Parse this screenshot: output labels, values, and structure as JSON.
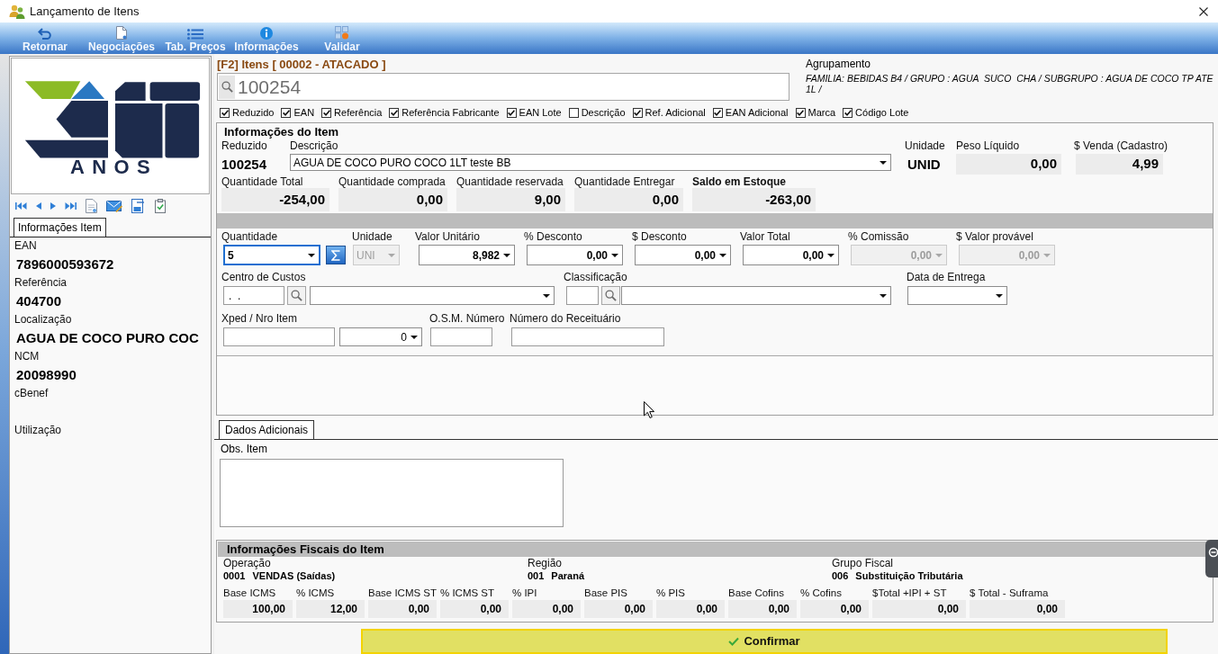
{
  "window": {
    "title": "Lançamento de Itens"
  },
  "toolbar": [
    {
      "label": "Retornar",
      "kind": "return"
    },
    {
      "label": "Negociações",
      "kind": "document"
    },
    {
      "label": "Tab. Preços",
      "kind": "list"
    },
    {
      "label": "Informações",
      "kind": "info"
    },
    {
      "label": "Validar",
      "kind": "validate"
    }
  ],
  "sidebar": {
    "logo_caption": "ANOS",
    "tabs": [
      {
        "label": "Informações Item",
        "selected": true
      }
    ],
    "fields": [
      {
        "label": "EAN",
        "value": "7896000593672"
      },
      {
        "label": "Referência",
        "value": "404700"
      },
      {
        "label": "Localização",
        "value": "AGUA DE COCO PURO COC"
      },
      {
        "label": "NCM",
        "value": "20098990"
      },
      {
        "label": "cBenef"
      },
      {
        "label": "Utilização"
      }
    ]
  },
  "item_search": {
    "title": "[F2] Itens [ 00002 - ATACADO ]",
    "value": "100254"
  },
  "grouping": {
    "label": "Agrupamento",
    "text": "FAMILIA: BEBIDAS B4 / GRUPO : AGUA  SUCO  CHA / SUBGRUPO : AGUA DE COCO TP ATE 1L /"
  },
  "search_filters": [
    {
      "label": "Reduzido",
      "checked": true
    },
    {
      "label": "EAN",
      "checked": true
    },
    {
      "label": "Referência",
      "checked": true
    },
    {
      "label": "Referência Fabricante",
      "checked": true
    },
    {
      "label": "EAN Lote",
      "checked": true
    },
    {
      "label": "Descrição",
      "checked": false
    },
    {
      "label": "Ref. Adicional",
      "checked": true
    },
    {
      "label": "EAN Adicional",
      "checked": true
    },
    {
      "label": "Marca",
      "checked": true
    },
    {
      "label": "Código Lote",
      "checked": true
    }
  ],
  "item_info": {
    "title": "Informações do Item",
    "code": {
      "label": "Reduzido",
      "value": "100254"
    },
    "description": {
      "label": "Descrição",
      "value": "AGUA DE COCO PURO COCO 1LT teste BB"
    },
    "unit": {
      "label": "Unidade",
      "value": "UNID"
    },
    "net_weight": {
      "label": "Peso Líquido",
      "value": "0,00"
    },
    "sale_price": {
      "label": "$ Venda (Cadastro)",
      "value": "4,99"
    },
    "quantities": [
      {
        "label": "Quantidade Total",
        "value": "-254,00",
        "kind": "plain"
      },
      {
        "label": "Quantidade comprada",
        "value": "0,00",
        "kind": "plain"
      },
      {
        "label": "Quantidade reservada",
        "value": "9,00",
        "kind": "plain"
      },
      {
        "label": "Quantidade Entregar",
        "value": "0,00",
        "kind": "plain"
      },
      {
        "label": "Saldo em Estoque",
        "value": "-263,00",
        "kind": "balance"
      }
    ]
  },
  "pricing_fields": [
    {
      "label": "Quantidade",
      "value": "5",
      "kind": "text",
      "focused": true,
      "disabled": false,
      "sum_button": true
    },
    {
      "label": "Unidade",
      "value": "UNI",
      "kind": "text",
      "focused": false,
      "disabled": true,
      "sum_button": false
    },
    {
      "label": "Valor Unitário",
      "value": "8,982",
      "kind": "number",
      "focused": false,
      "disabled": false,
      "sum_button": false
    },
    {
      "label": "% Desconto",
      "value": "0,00",
      "kind": "number",
      "focused": false,
      "disabled": false,
      "sum_button": false
    },
    {
      "label": "$ Desconto",
      "value": "0,00",
      "kind": "number",
      "focused": false,
      "disabled": false,
      "sum_button": false
    },
    {
      "label": "Valor Total",
      "value": "0,00",
      "kind": "number",
      "focused": false,
      "disabled": false,
      "sum_button": false
    },
    {
      "label": "% Comissão",
      "value": "0,00",
      "kind": "number",
      "focused": false,
      "disabled": true,
      "sum_button": false
    },
    {
      "label": "$ Valor provável",
      "value": "0,00",
      "kind": "number",
      "focused": false,
      "disabled": true,
      "sum_button": false
    }
  ],
  "cost_center": {
    "label": "Centro de Custos",
    "code": ".  ."
  },
  "classification": {
    "label": "Classificação"
  },
  "delivery_date": {
    "label": "Data de Entrega"
  },
  "order_reference": {
    "label": "Xped / Nro Item",
    "item_number": "0"
  },
  "osm_number": {
    "label": "O.S.M. Número"
  },
  "prescription_number": {
    "label": "Número do Receituário"
  },
  "additional_tabs": [
    {
      "label": "Dados Adicionais",
      "selected": true
    }
  ],
  "notes": {
    "label": "Obs. Item"
  },
  "fiscal": {
    "title": "Informações Fiscais do Item",
    "groups": [
      {
        "label": "Operação",
        "code": "0001",
        "value": "VENDAS (Saídas)"
      },
      {
        "label": "Região",
        "code": "001",
        "value": "Paraná"
      },
      {
        "label": "Grupo Fiscal",
        "code": "006",
        "value": "Substituição Tributária"
      }
    ],
    "values": [
      {
        "label": "Base ICMS",
        "value": "100,00"
      },
      {
        "label": "% ICMS",
        "value": "12,00"
      },
      {
        "label": "Base ICMS ST",
        "value": "0,00"
      },
      {
        "label": "% ICMS ST",
        "value": "0,00"
      },
      {
        "label": "% IPI",
        "value": "0,00"
      },
      {
        "label": "Base PIS",
        "value": "0,00"
      },
      {
        "label": "% PIS",
        "value": "0,00"
      },
      {
        "label": "Base Cofins",
        "value": "0,00"
      },
      {
        "label": "% Cofins",
        "value": "0,00"
      },
      {
        "label": "$Total +IPI + ST",
        "value": "0,00"
      },
      {
        "label": "$ Total - Suframa",
        "value": "0,00"
      }
    ]
  },
  "confirm_button": {
    "label": "Confirmar"
  }
}
